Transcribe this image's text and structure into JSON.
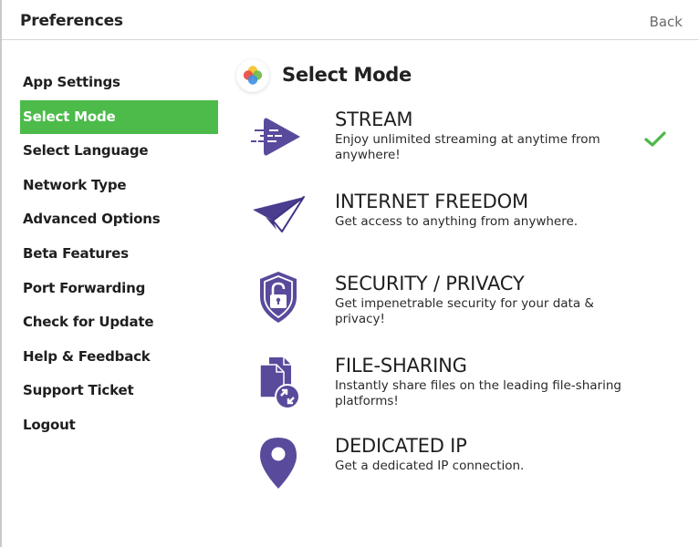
{
  "header": {
    "title": "Preferences",
    "back_label": "Back"
  },
  "sidebar": {
    "items": [
      {
        "label": "App Settings",
        "active": false
      },
      {
        "label": "Select Mode",
        "active": true
      },
      {
        "label": "Select Language",
        "active": false
      },
      {
        "label": "Network Type",
        "active": false
      },
      {
        "label": "Advanced Options",
        "active": false
      },
      {
        "label": "Beta Features",
        "active": false
      },
      {
        "label": "Port Forwarding",
        "active": false
      },
      {
        "label": "Check for Update",
        "active": false
      },
      {
        "label": "Help & Feedback",
        "active": false
      },
      {
        "label": "Support Ticket",
        "active": false
      },
      {
        "label": "Logout",
        "active": false
      }
    ]
  },
  "main": {
    "title": "Select Mode",
    "modes": [
      {
        "title": "STREAM",
        "description": "Enjoy unlimited streaming at anytime from anywhere!",
        "icon": "play-stream-icon",
        "selected": true
      },
      {
        "title": "INTERNET FREEDOM",
        "description": "Get access to anything from anywhere.",
        "icon": "paper-plane-icon",
        "selected": false
      },
      {
        "title": "SECURITY / PRIVACY",
        "description": "Get impenetrable security for your data & privacy!",
        "icon": "shield-lock-icon",
        "selected": false
      },
      {
        "title": "FILE-SHARING",
        "description": "Instantly share files on the leading file-sharing platforms!",
        "icon": "file-share-icon",
        "selected": false
      },
      {
        "title": "DEDICATED IP",
        "description": "Get a dedicated IP connection.",
        "icon": "map-pin-icon",
        "selected": false
      }
    ]
  },
  "colors": {
    "accent_green": "#4cbb4a",
    "icon_purple": "#5a4a9c",
    "check_green": "#4cb848"
  }
}
